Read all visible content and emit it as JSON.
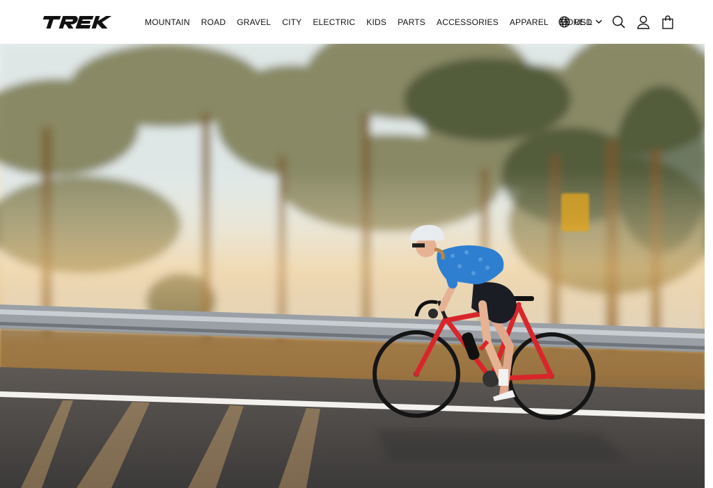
{
  "brand": {
    "logo_text": "TREK",
    "logo_color": "#111111"
  },
  "nav": {
    "items": [
      {
        "label": "MOUNTAIN"
      },
      {
        "label": "ROAD"
      },
      {
        "label": "GRAVEL"
      },
      {
        "label": "CITY"
      },
      {
        "label": "ELECTRIC"
      },
      {
        "label": "KIDS"
      },
      {
        "label": "PARTS"
      },
      {
        "label": "ACCESSORIES"
      },
      {
        "label": "APPAREL"
      },
      {
        "label": "MORE L"
      }
    ]
  },
  "currency": {
    "label": "USD",
    "icon": "globe-icon",
    "chevron": "chevron-down-icon"
  },
  "header_icons": [
    "search-icon",
    "account-icon",
    "cart-icon"
  ],
  "hero": {
    "image": "cyclist-road-bike-sunset",
    "colors": {
      "jersey": "#2f7fd0",
      "bike_frame": "#d8262a",
      "asphalt": "#4a4846",
      "sunlight": "#f4c178"
    }
  }
}
